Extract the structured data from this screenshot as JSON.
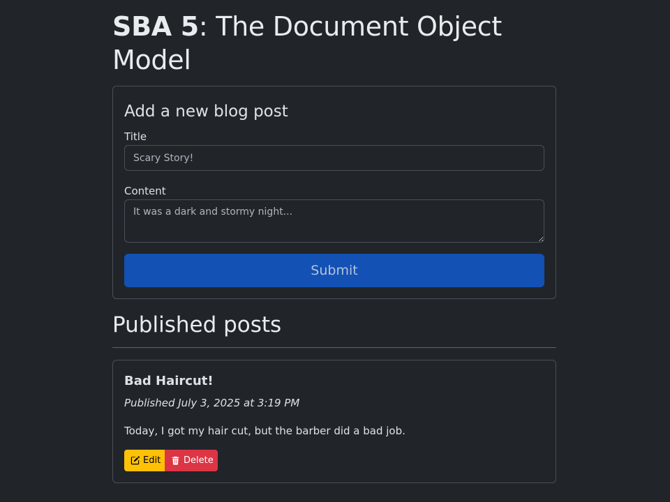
{
  "page": {
    "title_bold": "SBA 5",
    "title_rest": ": The Document Object Model"
  },
  "form": {
    "heading": "Add a new blog post",
    "title_label": "Title",
    "title_value": "Scary Story!",
    "content_label": "Content",
    "content_value": "It was a dark and stormy night...",
    "submit_label": "Submit"
  },
  "posts_section": {
    "heading": "Published posts",
    "posts": [
      {
        "title": "Bad Haircut!",
        "published": "Published July 3, 2025 at 3:19 PM",
        "body": "Today, I got my hair cut, but the barber did a bad job.",
        "edit_label": "Edit",
        "edit_icon": "pencil-square-icon",
        "delete_label": "Delete",
        "delete_icon": "trash-icon"
      }
    ]
  },
  "colors": {
    "background": "#212529",
    "primary": "#1351b4",
    "warning": "#ffc107",
    "danger": "#dc3545"
  }
}
